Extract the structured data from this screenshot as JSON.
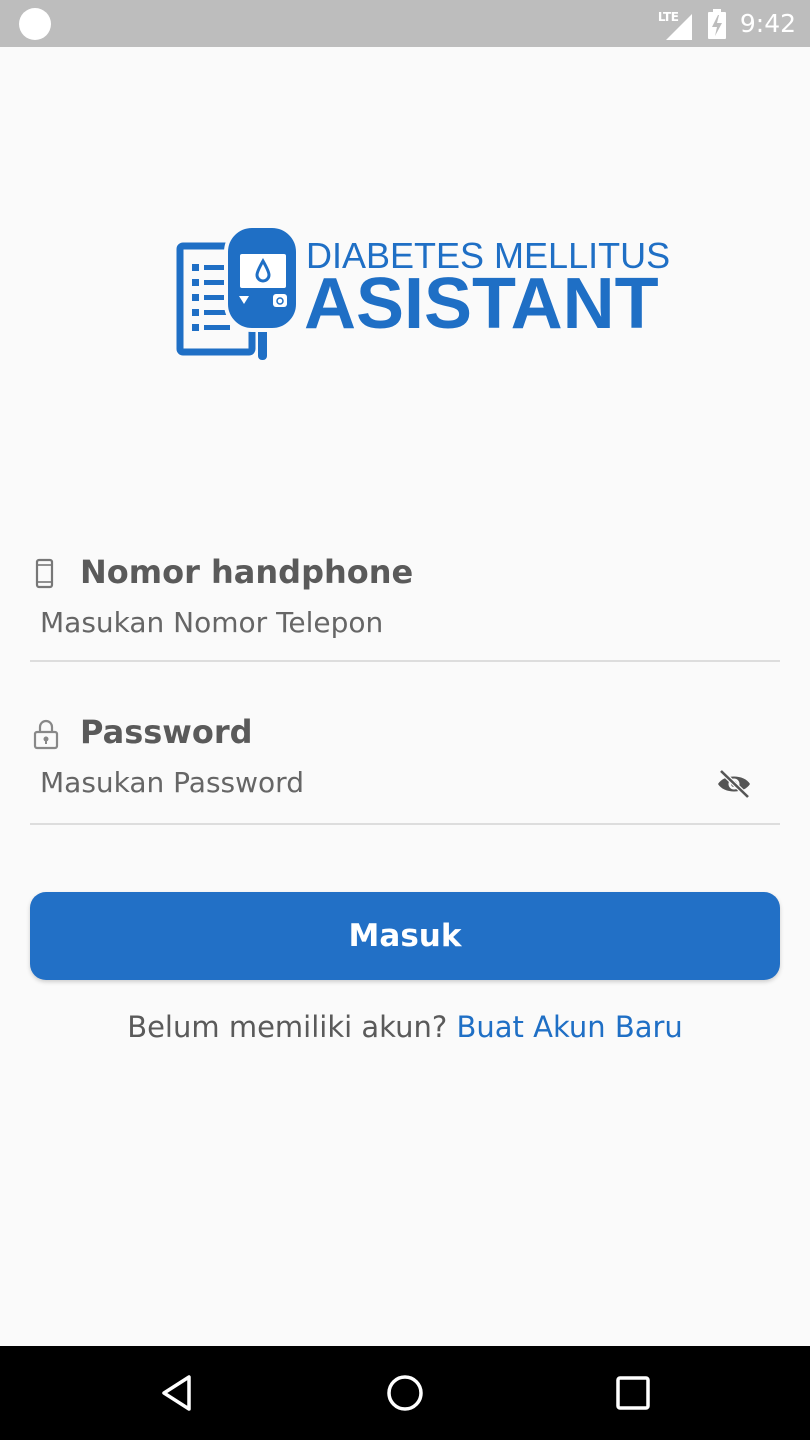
{
  "status_bar": {
    "network": "LTE",
    "time": "9:42"
  },
  "logo": {
    "line1": "DIABETES MELLITUS",
    "line2": "ASISTANT",
    "icon": "glucose-meter-icon"
  },
  "phone_field": {
    "label": "Nomor handphone",
    "placeholder": "Masukan Nomor Telepon",
    "value": "",
    "icon": "phone-icon"
  },
  "password_field": {
    "label": "Password",
    "placeholder": "Masukan Password",
    "value": "",
    "icon": "lock-icon",
    "toggle_icon": "eye-off-icon"
  },
  "login_button": {
    "label": "Masuk"
  },
  "register": {
    "prompt": "Belum memiliki akun?",
    "link": "Buat Akun Baru"
  },
  "colors": {
    "primary": "#1f6fc5",
    "button": "#2270c6",
    "text": "#5a5a5a",
    "status_bar": "#bdbdbd",
    "nav_bar": "#000000"
  }
}
